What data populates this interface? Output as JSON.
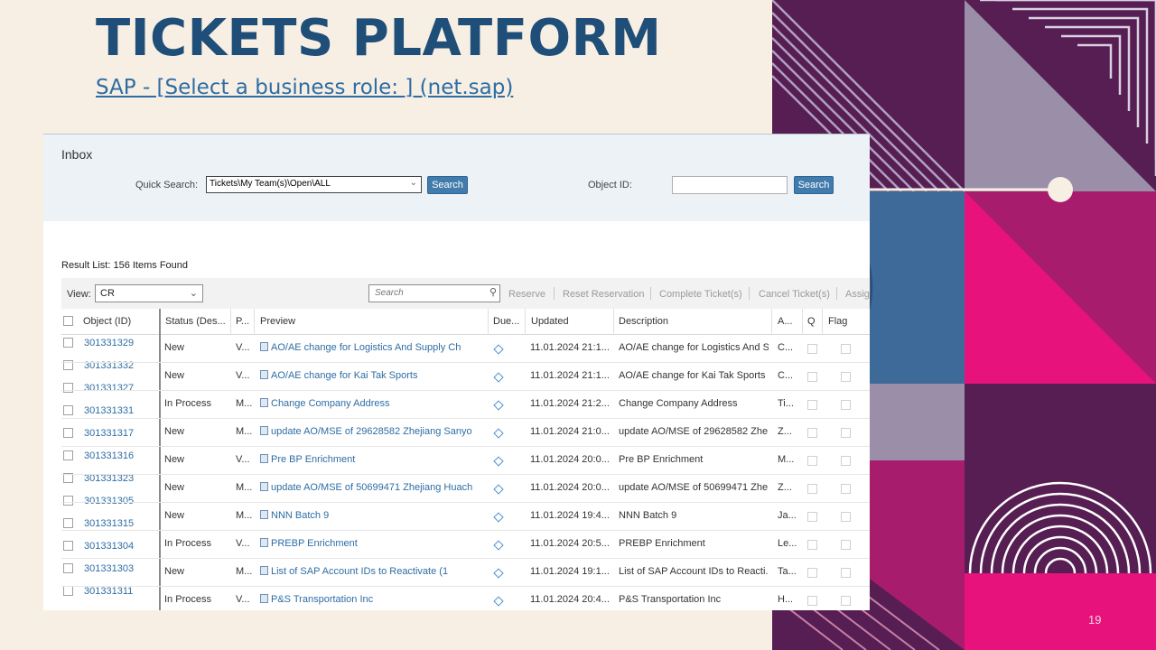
{
  "slide": {
    "title": "TICKETS PLATFORM",
    "link": "SAP - [Select a business role: ] (net.sap)",
    "page_number": "19"
  },
  "inbox": {
    "title": "Inbox",
    "quick_search_label": "Quick Search:",
    "quick_search_value": "Tickets\\My Team(s)\\Open\\ALL",
    "search_button": "Search",
    "object_id_label": "Object ID:",
    "object_id_value": "",
    "object_id_search_button": "Search"
  },
  "result_list": {
    "label": "Result List: 156 Items Found",
    "view_label": "View:",
    "view_value": "CR",
    "search_placeholder": "Search",
    "actions": [
      "Reserve",
      "Reset Reservation",
      "Complete Ticket(s)",
      "Cancel Ticket(s)",
      "Assign"
    ]
  },
  "columns": {
    "object_id": "Object (ID)",
    "status": "Status (Des...",
    "p": "P...",
    "preview": "Preview",
    "due": "Due...",
    "updated": "Updated",
    "description": "Description",
    "a": "A...",
    "q": "Q",
    "flag": "Flag"
  },
  "object_ids": [
    "301331329",
    "301331332",
    "301331327",
    "301331331",
    "301331317",
    "301331316",
    "301331323",
    "301331305",
    "301331315",
    "301331304",
    "301331303",
    "301331311"
  ],
  "rows": [
    {
      "status": "New",
      "p": "V...",
      "preview": "AO/AE change for Logistics And Supply Ch",
      "updated": "11.01.2024 21:1...",
      "description": "AO/AE change for Logistics And S...",
      "a": "C..."
    },
    {
      "status": "New",
      "p": "V...",
      "preview": "AO/AE change for Kai Tak Sports",
      "updated": "11.01.2024 21:1...",
      "description": "AO/AE change for Kai Tak Sports",
      "a": "C..."
    },
    {
      "status": "In Process",
      "p": "M...",
      "preview": "Change Company Address",
      "updated": "11.01.2024 21:2...",
      "description": "Change Company Address",
      "a": "Ti..."
    },
    {
      "status": "New",
      "p": "M...",
      "preview": "update AO/MSE of 29628582 Zhejiang Sanyo",
      "updated": "11.01.2024 21:0...",
      "description": "update AO/MSE of 29628582 Zhe...",
      "a": "Z..."
    },
    {
      "status": "New",
      "p": "V...",
      "preview": "Pre BP Enrichment",
      "updated": "11.01.2024 20:0...",
      "description": "Pre BP Enrichment",
      "a": "M..."
    },
    {
      "status": "New",
      "p": "M...",
      "preview": "update AO/MSE of 50699471 Zhejiang Huach",
      "updated": "11.01.2024 20:0...",
      "description": "update AO/MSE of 50699471 Zhe...",
      "a": "Z..."
    },
    {
      "status": "New",
      "p": "M...",
      "preview": "NNN Batch 9",
      "updated": "11.01.2024 19:4...",
      "description": "NNN Batch 9",
      "a": "Ja..."
    },
    {
      "status": "In Process",
      "p": "V...",
      "preview": "PREBP Enrichment",
      "updated": "11.01.2024 20:5...",
      "description": "PREBP Enrichment",
      "a": "Le..."
    },
    {
      "status": "New",
      "p": "M...",
      "preview": "List of SAP Account IDs to Reactivate (1",
      "updated": "11.01.2024 19:1...",
      "description": "List of SAP Account IDs to Reacti...",
      "a": "Ta..."
    },
    {
      "status": "In Process",
      "p": "V...",
      "preview": "P&S Transportation Inc",
      "updated": "11.01.2024 20:4...",
      "description": "P&S Transportation Inc",
      "a": "H..."
    }
  ],
  "colors": {
    "title": "#1f4e79",
    "link": "#2e6da4",
    "button": "#427cac",
    "deco_purple": "#561e52",
    "deco_magenta": "#e8127c",
    "deco_gray": "#9a8ea8"
  }
}
